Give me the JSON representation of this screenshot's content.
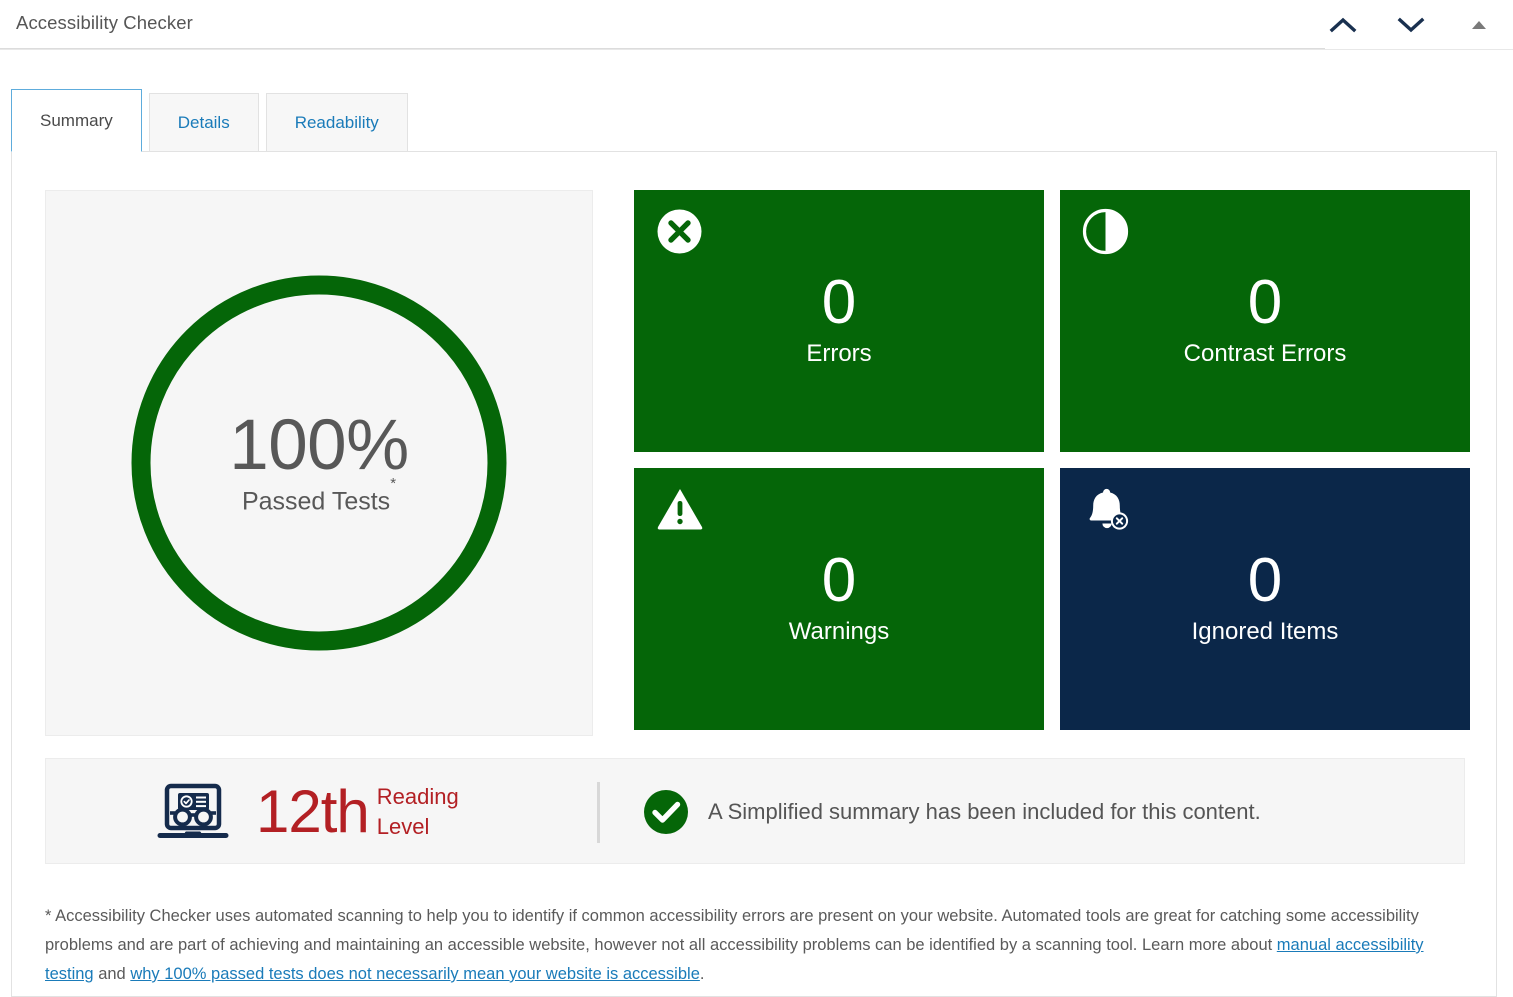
{
  "header": {
    "title": "Accessibility Checker",
    "actions": [
      {
        "name": "collapse-up-button",
        "icon": "chevron-up-icon"
      },
      {
        "name": "expand-down-button",
        "icon": "chevron-down-icon"
      },
      {
        "name": "panel-toggle-button",
        "icon": "triangle-up-icon"
      }
    ]
  },
  "tabs": [
    {
      "label": "Summary",
      "active": true
    },
    {
      "label": "Details",
      "active": false
    },
    {
      "label": "Readability",
      "active": false
    }
  ],
  "gauge": {
    "percent": "100%",
    "label": "Passed Tests",
    "asterisk": "*",
    "value": 100,
    "ring_color": "#056608",
    "track_color": "#f6f6f6"
  },
  "tiles": [
    {
      "id": "errors",
      "icon": "x-circle-icon",
      "count": "0",
      "label": "Errors",
      "color": "#056608"
    },
    {
      "id": "contrast-errors",
      "icon": "contrast-half-circle-icon",
      "count": "0",
      "label": "Contrast Errors",
      "color": "#056608"
    },
    {
      "id": "warnings",
      "icon": "warning-triangle-icon",
      "count": "0",
      "label": "Warnings",
      "color": "#056608"
    },
    {
      "id": "ignored-items",
      "icon": "bell-off-icon",
      "count": "0",
      "label": "Ignored Items",
      "color": "#0b2749"
    }
  ],
  "reading": {
    "icon": "laptop-glasses-icon",
    "grade": "12th",
    "line1": "Reading",
    "line2": "Level",
    "accent": "#b32024"
  },
  "simplified_summary": {
    "icon": "check-circle-icon",
    "text": "A Simplified summary has been included for this content.",
    "color": "#056608"
  },
  "footnote": {
    "part1": "* Accessibility Checker uses automated scanning to help you to identify if common accessibility errors are present on your website. Automated tools are great for catching some accessibility problems and are part of achieving and maintaining an accessible website, however not all accessibility problems can be identified by a scanning tool. Learn more about ",
    "link1": "manual accessibility testing",
    "part2": " and ",
    "link2": "why 100% passed tests does not necessarily mean your website is accessible",
    "part3": "."
  }
}
